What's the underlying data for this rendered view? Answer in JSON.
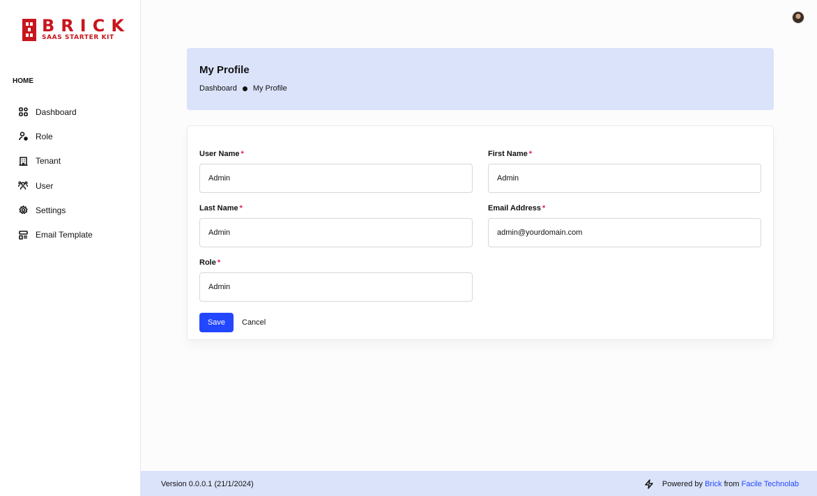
{
  "brand": {
    "name": "BRICK",
    "tagline": "SAAS STARTER KIT",
    "color": "#c8161d"
  },
  "sidebar": {
    "section_title": "HOME",
    "items": [
      {
        "label": "Dashboard",
        "icon": "dashboard-icon"
      },
      {
        "label": "Role",
        "icon": "role-icon"
      },
      {
        "label": "Tenant",
        "icon": "building-icon"
      },
      {
        "label": "User",
        "icon": "users-icon"
      },
      {
        "label": "Settings",
        "icon": "gear-icon"
      },
      {
        "label": "Email Template",
        "icon": "email-template-icon"
      }
    ]
  },
  "header": {
    "title": "My Profile",
    "breadcrumb": [
      "Dashboard",
      "My Profile"
    ]
  },
  "form": {
    "username": {
      "label": "User Name",
      "required_mark": "*",
      "value": "Admin"
    },
    "first_name": {
      "label": "First Name",
      "required_mark": "*",
      "value": "Admin"
    },
    "last_name": {
      "label": "Last Name",
      "required_mark": "*",
      "value": "Admin"
    },
    "email": {
      "label": "Email Address",
      "required_mark": "*",
      "value": "admin@yourdomain.com"
    },
    "role": {
      "label": "Role",
      "required_mark": "*",
      "value": "Admin"
    },
    "save_label": "Save",
    "cancel_label": "Cancel"
  },
  "footer": {
    "version": "Version 0.0.0.1 (21/1/2024)",
    "powered_prefix": "Powered by ",
    "powered_brand": "Brick",
    "powered_middle": " from ",
    "powered_company": "Facile Technolab"
  },
  "colors": {
    "accent": "#2346ff",
    "header_bg": "#dbe3fb",
    "required": "#e11d48"
  }
}
